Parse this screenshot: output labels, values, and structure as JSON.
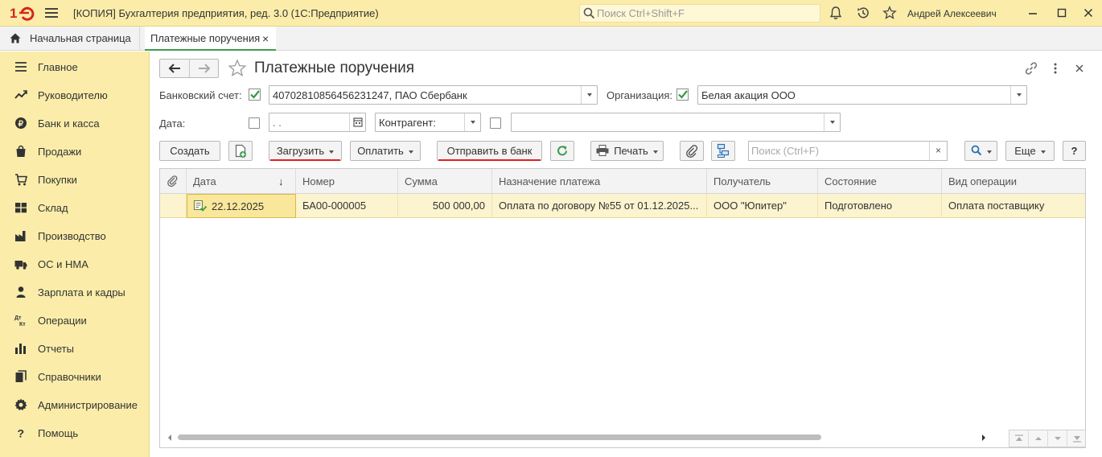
{
  "titlebar": {
    "logo": "1С",
    "title": "[КОПИЯ] Бухгалтерия предприятия, ред. 3.0  (1С:Предприятие)",
    "search_placeholder": "Поиск Ctrl+Shift+F",
    "user": "Андрей Алексеевич",
    "icons": [
      "bell-icon",
      "history-icon",
      "star-icon"
    ]
  },
  "tabs": {
    "home": "Начальная страница",
    "active": "Платежные поручения",
    "close": "×"
  },
  "sidebar": {
    "items": [
      {
        "label": "Главное",
        "icon": "menu-lines-icon"
      },
      {
        "label": "Руководителю",
        "icon": "trend-icon"
      },
      {
        "label": "Банк и касса",
        "icon": "ruble-coin-icon"
      },
      {
        "label": "Продажи",
        "icon": "shopping-bag-icon"
      },
      {
        "label": "Покупки",
        "icon": "cart-icon"
      },
      {
        "label": "Склад",
        "icon": "warehouse-icon"
      },
      {
        "label": "Производство",
        "icon": "factory-icon"
      },
      {
        "label": "ОС и НМА",
        "icon": "truck-icon"
      },
      {
        "label": "Зарплата и кадры",
        "icon": "person-icon"
      },
      {
        "label": "Операции",
        "icon": "dt-kt-icon"
      },
      {
        "label": "Отчеты",
        "icon": "bar-chart-icon"
      },
      {
        "label": "Справочники",
        "icon": "books-icon"
      },
      {
        "label": "Администрирование",
        "icon": "gear-icon"
      },
      {
        "label": "Помощь",
        "icon": "question-icon"
      }
    ]
  },
  "form": {
    "title": "Платежные поручения",
    "bank_account_label": "Банковский счет:",
    "bank_account_value": "40702810856456231247, ПАО Сбербанк",
    "organization_label": "Организация:",
    "organization_value": "Белая акация ООО",
    "date_label": "Дата:",
    "date_value": " .  .",
    "counterparty_mode": "Контрагент:",
    "counterparty_value": ""
  },
  "toolbar": {
    "create": "Создать",
    "load": "Загрузить",
    "pay": "Оплатить",
    "send_to_bank": "Отправить в банк",
    "print": "Печать",
    "search_placeholder": "Поиск (Ctrl+F)",
    "clear": "×",
    "more": "Еще",
    "help": "?"
  },
  "table": {
    "columns": [
      "Дата",
      "Номер",
      "Сумма",
      "Назначение платежа",
      "Получатель",
      "Состояние",
      "Вид операции"
    ],
    "sort_indicator": "↓",
    "rows": [
      {
        "date": "22.12.2025",
        "number": "БА00-000005",
        "amount": "500 000,00",
        "purpose": "Оплата по договору №55 от 01.12.2025...",
        "recipient": "ООО \"Юпитер\"",
        "status": "Подготовлено",
        "operation": "Оплата поставщику"
      }
    ]
  },
  "colors": {
    "panel_yellow": "#fbeda9",
    "row_highlight": "#fcf3cf",
    "accent_green": "#3f9a4e",
    "underline_red": "#e02020"
  }
}
